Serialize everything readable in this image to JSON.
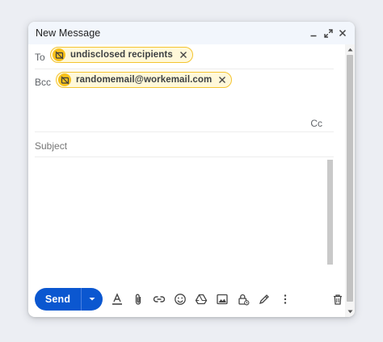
{
  "window": {
    "title": "New Message",
    "controls": [
      "minimize-icon",
      "pop-out-icon",
      "close-icon"
    ]
  },
  "to": {
    "label": "To",
    "chip": {
      "text": "undisclosed recipients",
      "avatar_icon": "no-photo-icon",
      "remove_icon": "close-icon"
    }
  },
  "bcc": {
    "label": "Bcc",
    "chip": {
      "text": "randomemail@workemail.com",
      "avatar_icon": "no-photo-icon",
      "remove_icon": "close-icon"
    }
  },
  "cc": {
    "label": "Cc"
  },
  "subject": {
    "placeholder": "Subject",
    "value": ""
  },
  "body": {
    "value": ""
  },
  "toolbar": {
    "send_label": "Send",
    "send_options_icon": "caret-down-icon",
    "icons": [
      "format-text-icon",
      "attach-icon",
      "link-icon",
      "emoji-icon",
      "drive-icon",
      "photo-icon",
      "confidential-lock-icon",
      "signature-pen-icon",
      "more-vert-icon"
    ],
    "discard_icon": "trash-icon"
  },
  "colors": {
    "accent": "#0b57d0",
    "chip_border": "#f4c430",
    "chip_bg": "#fff8d9",
    "avatar_bg": "#f7c11b",
    "titlebar_bg": "#f2f6fc",
    "page_bg": "#eceef3"
  }
}
